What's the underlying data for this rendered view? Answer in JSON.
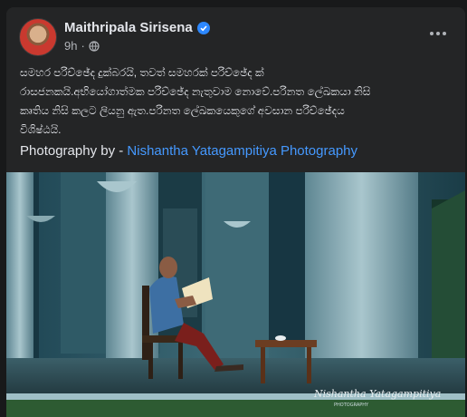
{
  "post": {
    "author": "Maithripala Sirisena",
    "time": "9h",
    "separator": "·",
    "body_lines": [
      "සමහර පරිච්ඡේද දුක්බරයි, තවත් සමහරක් පරිච්ඡේද ක්",
      "රාසජනකයි.අභියෝගාත්මක පරිච්ඡේද නැතුවාම නොවේ.පරිනත ලේඛකයා නිසි",
      "කෘතිය නිසි කලට ලියනු ඇත.පරිනත ලේඛකයෙකුගේ අවසාන පරිච්ඡේදය",
      "විශිෂ්ඨයි."
    ],
    "credit_prefix": "Photography by - ",
    "credit_link": "Nishantha Yatagampitiya Photography"
  },
  "photo": {
    "watermark": "Nishantha Yatagampitiya",
    "watermark_sub": "PHOTOGRAPHY"
  },
  "colors": {
    "background": "#18191a",
    "card": "#242526",
    "link": "#4599ff",
    "verified": "#2d88ff"
  },
  "icons": [
    "verified-badge-icon",
    "globe-icon",
    "more-options-icon"
  ]
}
